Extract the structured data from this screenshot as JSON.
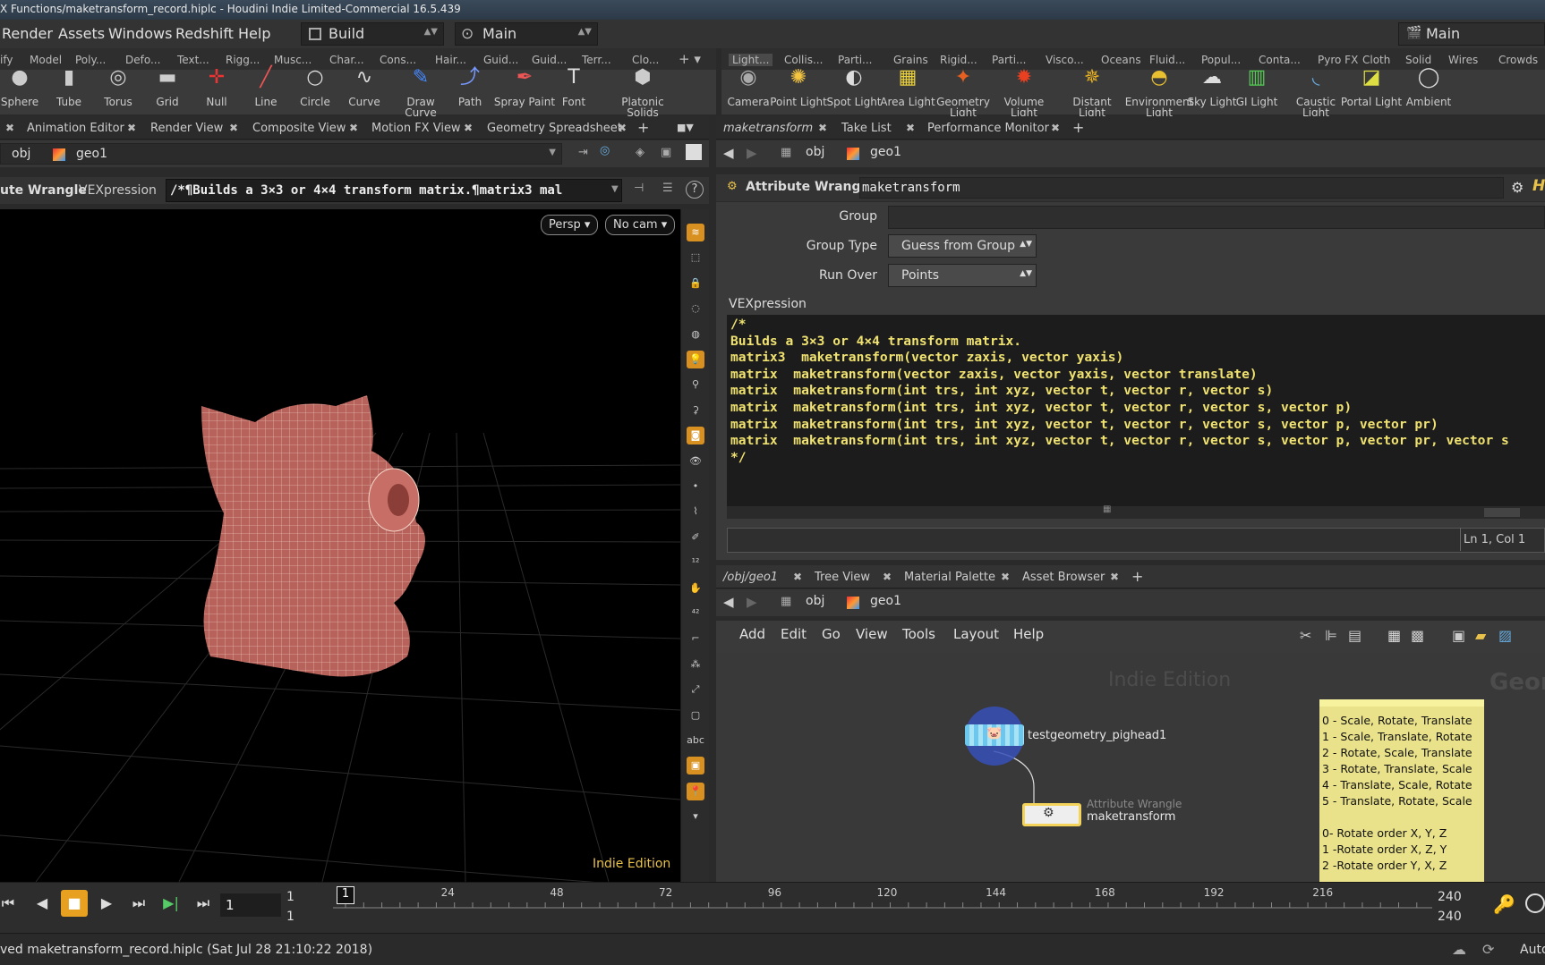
{
  "title_bar": "X Functions/maketransform_record.hiplc - Houdini Indie Limited-Commercial 16.5.439",
  "menu": {
    "items": [
      "Render",
      "Assets",
      "Windows",
      "Redshift",
      "Help"
    ],
    "desktop": "Build",
    "viewer": "Main",
    "right_desktop": "Main"
  },
  "shelf_tabs_left": [
    "ify",
    "Model",
    "Poly...",
    "Defo...",
    "Text...",
    "Rigg...",
    "Musc...",
    "Char...",
    "Cons...",
    "Hair...",
    "Guid...",
    "Guid...",
    "Terr...",
    "Clo..."
  ],
  "shelf_tabs_right": [
    "Light...",
    "Collis...",
    "Parti...",
    "Grains",
    "Rigid...",
    "Parti...",
    "Visco...",
    "Oceans",
    "Fluid...",
    "Popul...",
    "Conta...",
    "Pyro FX",
    "Cloth",
    "Solid",
    "Wires",
    "Crowds"
  ],
  "shelf_tools_left": [
    "Sphere",
    "Tube",
    "Torus",
    "Grid",
    "Null",
    "Line",
    "Circle",
    "Curve",
    "Draw Curve",
    "Path",
    "Spray Paint",
    "Font",
    "Platonic Solids"
  ],
  "shelf_tools_right": [
    "Camera",
    "Point Light",
    "Spot Light",
    "Area Light",
    "Geometry Light",
    "Volume Light",
    "Distant Light",
    "Environment Light",
    "Sky Light",
    "GI Light",
    "Caustic Light",
    "Portal Light",
    "Ambient"
  ],
  "left_pane_tabs": [
    "Animation Editor",
    "Render View",
    "Composite View",
    "Motion FX View",
    "Geometry Spreadsheet"
  ],
  "path": {
    "obj": "obj",
    "geo": "geo1",
    "net_path": "/obj/geo1"
  },
  "wrangle_bar": {
    "node_type": "ute Wrangle",
    "field_label": "VEXpression",
    "snippet": "/*¶Builds a 3×3 or 4×4 transform matrix.¶matrix3  mal"
  },
  "viewport": {
    "persp": "Persp",
    "cam": "No cam",
    "watermark": "Indie Edition"
  },
  "right_top_tabs": [
    "maketransform",
    "Take List",
    "Performance Monitor"
  ],
  "params": {
    "node_type": "Attribute Wrangle",
    "node_name": "maketransform",
    "group_label": "Group",
    "group_value": "",
    "group_type_label": "Group Type",
    "group_type_value": "Guess from Group",
    "run_over_label": "Run Over",
    "run_over_value": "Points",
    "vex_label": "VEXpression",
    "code_lines": [
      "/*",
      "Builds a 3×3 or 4×4 transform matrix.",
      "matrix3  maketransform(vector zaxis, vector yaxis)",
      "matrix  maketransform(vector zaxis, vector yaxis, vector translate)",
      "matrix  maketransform(int trs, int xyz, vector t, vector r, vector s)",
      "matrix  maketransform(int trs, int xyz, vector t, vector r, vector s, vector p)",
      "matrix  maketransform(int trs, int xyz, vector t, vector r, vector s, vector p, vector pr)",
      "matrix  maketransform(int trs, int xyz, vector t, vector r, vector s, vector p, vector pr, vector s",
      "*/"
    ],
    "cursor_pos": "Ln 1, Col 1"
  },
  "network_tabs": [
    "/obj/geo1",
    "Tree View",
    "Material Palette",
    "Asset Browser"
  ],
  "network_menu": [
    "Add",
    "Edit",
    "Go",
    "View",
    "Tools",
    "Layout",
    "Help"
  ],
  "network": {
    "watermark": "Indie Edition",
    "context_label": "Geom",
    "node1": "testgeometry_pighead1",
    "node2_type": "Attribute Wrangle",
    "node2_name": "maketransform",
    "sticky_lines": [
      "0 - Scale, Rotate, Translate",
      "1 - Scale, Translate, Rotate",
      "2 - Rotate, Scale, Translate",
      "3 - Rotate, Translate, Scale",
      "4 - Translate, Scale, Rotate",
      "5 - Translate, Rotate, Scale",
      "",
      "0- Rotate order X, Y, Z",
      "1 -Rotate order X, Z, Y",
      "2 -Rotate order Y, X, Z"
    ]
  },
  "timeline": {
    "frame": "1",
    "start1": "1",
    "start2": "1",
    "current_marker": "1",
    "ticks": [
      "24",
      "48",
      "72",
      "96",
      "120",
      "144",
      "168",
      "192",
      "216"
    ],
    "end1": "240",
    "end2": "240"
  },
  "status": {
    "message": "ved maketransform_record.hiplc (Sat Jul 28 21:10:22 2018)",
    "right": "Auto"
  },
  "colors": {
    "code_text": "#f0e270",
    "node_select": "#f3d35a",
    "sticky": "#e9e28a",
    "viewport_bg": "#000000"
  }
}
